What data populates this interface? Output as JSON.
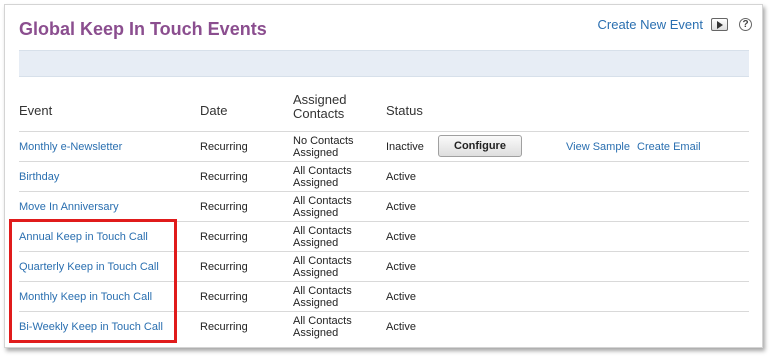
{
  "page": {
    "title": "Global Keep In Touch Events",
    "create_new_event": "Create New Event",
    "play_icon": "play-icon",
    "help_icon": "help-icon",
    "help_glyph": "?"
  },
  "table": {
    "headers": {
      "event": "Event",
      "date": "Date",
      "assigned_line1": "Assigned",
      "assigned_line2": "Contacts",
      "status": "Status"
    },
    "rows": [
      {
        "event": "Monthly e-Newsletter",
        "date": "Recurring",
        "contacts_line1": "No Contacts",
        "contacts_line2": "Assigned",
        "status": "Inactive",
        "configure": "Configure",
        "view_sample": "View Sample",
        "create_email": "Create Email"
      },
      {
        "event": "Birthday",
        "date": "Recurring",
        "contacts_line1": "All Contacts",
        "contacts_line2": "Assigned",
        "status": "Active"
      },
      {
        "event": "Move In Anniversary",
        "date": "Recurring",
        "contacts_line1": "All Contacts",
        "contacts_line2": "Assigned",
        "status": "Active"
      },
      {
        "event": "Annual Keep in Touch Call",
        "date": "Recurring",
        "contacts_line1": "All Contacts",
        "contacts_line2": "Assigned",
        "status": "Active"
      },
      {
        "event": "Quarterly Keep in Touch Call",
        "date": "Recurring",
        "contacts_line1": "All Contacts",
        "contacts_line2": "Assigned",
        "status": "Active"
      },
      {
        "event": "Monthly Keep in Touch Call",
        "date": "Recurring",
        "contacts_line1": "All Contacts",
        "contacts_line2": "Assigned",
        "status": "Active"
      },
      {
        "event": "Bi-Weekly Keep in Touch Call",
        "date": "Recurring",
        "contacts_line1": "All Contacts",
        "contacts_line2": "Assigned",
        "status": "Active"
      }
    ]
  },
  "colors": {
    "title": "#8b4e8f",
    "link": "#2a6fb0",
    "band": "#e7edf5",
    "highlight_border": "#e01b1b"
  }
}
